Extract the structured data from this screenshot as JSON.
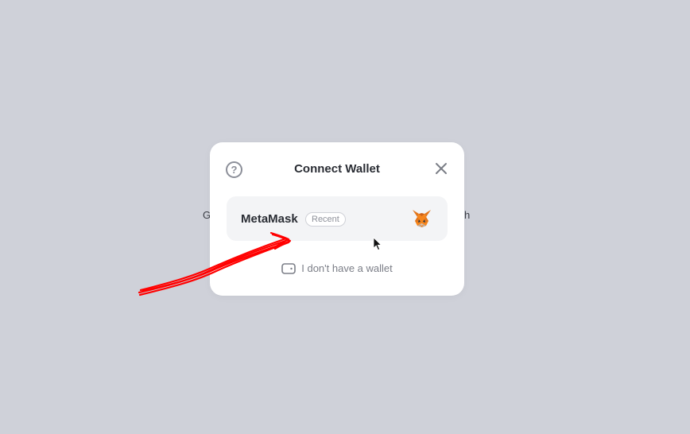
{
  "background": {
    "left_text": "G",
    "right_text": "h"
  },
  "modal": {
    "title": "Connect Wallet",
    "help_label": "?",
    "wallets": [
      {
        "name": "MetaMask",
        "badge": "Recent",
        "icon": "metamask-fox-icon"
      }
    ],
    "no_wallet_label": "I don't have a wallet"
  },
  "colors": {
    "backdrop": "#cfd1d9",
    "annotation_arrow": "#ff0000"
  }
}
